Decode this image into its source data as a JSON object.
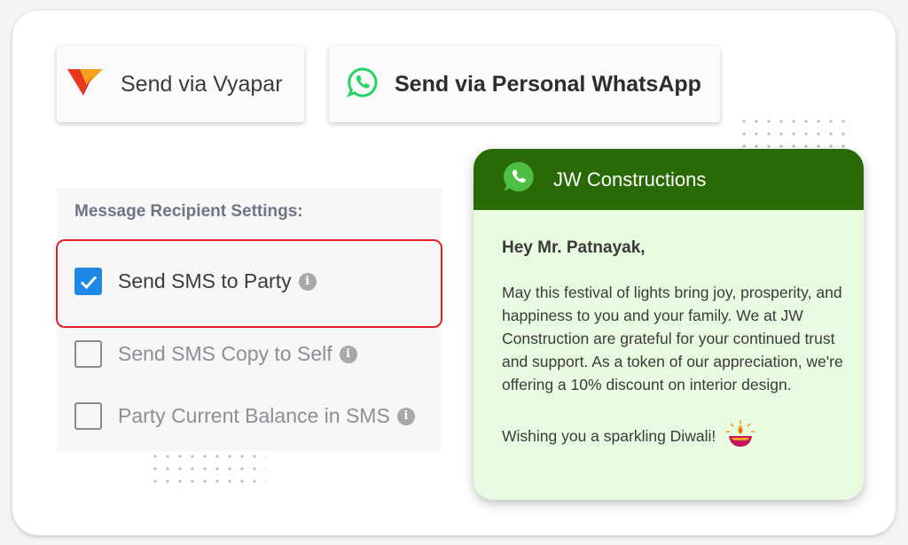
{
  "send_options": {
    "vyapar_label": "Send via Vyapar",
    "whatsapp_label": "Send via Personal WhatsApp"
  },
  "recipient_settings": {
    "heading": "Message Recipient Settings:",
    "options": [
      {
        "label": "Send SMS to Party",
        "checked": true
      },
      {
        "label": "Send SMS Copy to Self",
        "checked": false
      },
      {
        "label": "Party Current Balance in SMS",
        "checked": false
      }
    ],
    "info_glyph": "i"
  },
  "whatsapp_preview": {
    "sender": "JW Constructions",
    "greeting": "Hey Mr. Patnayak,",
    "message": "May this festival of lights bring joy, prosperity, and happiness to you and your family. We at JW Construction are grateful for your continued trust and support. As a token of our appreciation, we're offering a 10% discount on interior design.",
    "closing": "Wishing you a sparkling Diwali!"
  },
  "icons": {
    "vyapar": "vyapar-logo-icon",
    "whatsapp": "whatsapp-icon",
    "info": "info-icon",
    "check": "checkmark-icon",
    "diya": "diya-lamp-icon"
  },
  "colors": {
    "accent_blue": "#1e88e5",
    "highlight_red": "#e32027",
    "whatsapp_green": "#25d366",
    "wa_header": "#2a6a06",
    "wa_bubble": "#e8fadf"
  }
}
